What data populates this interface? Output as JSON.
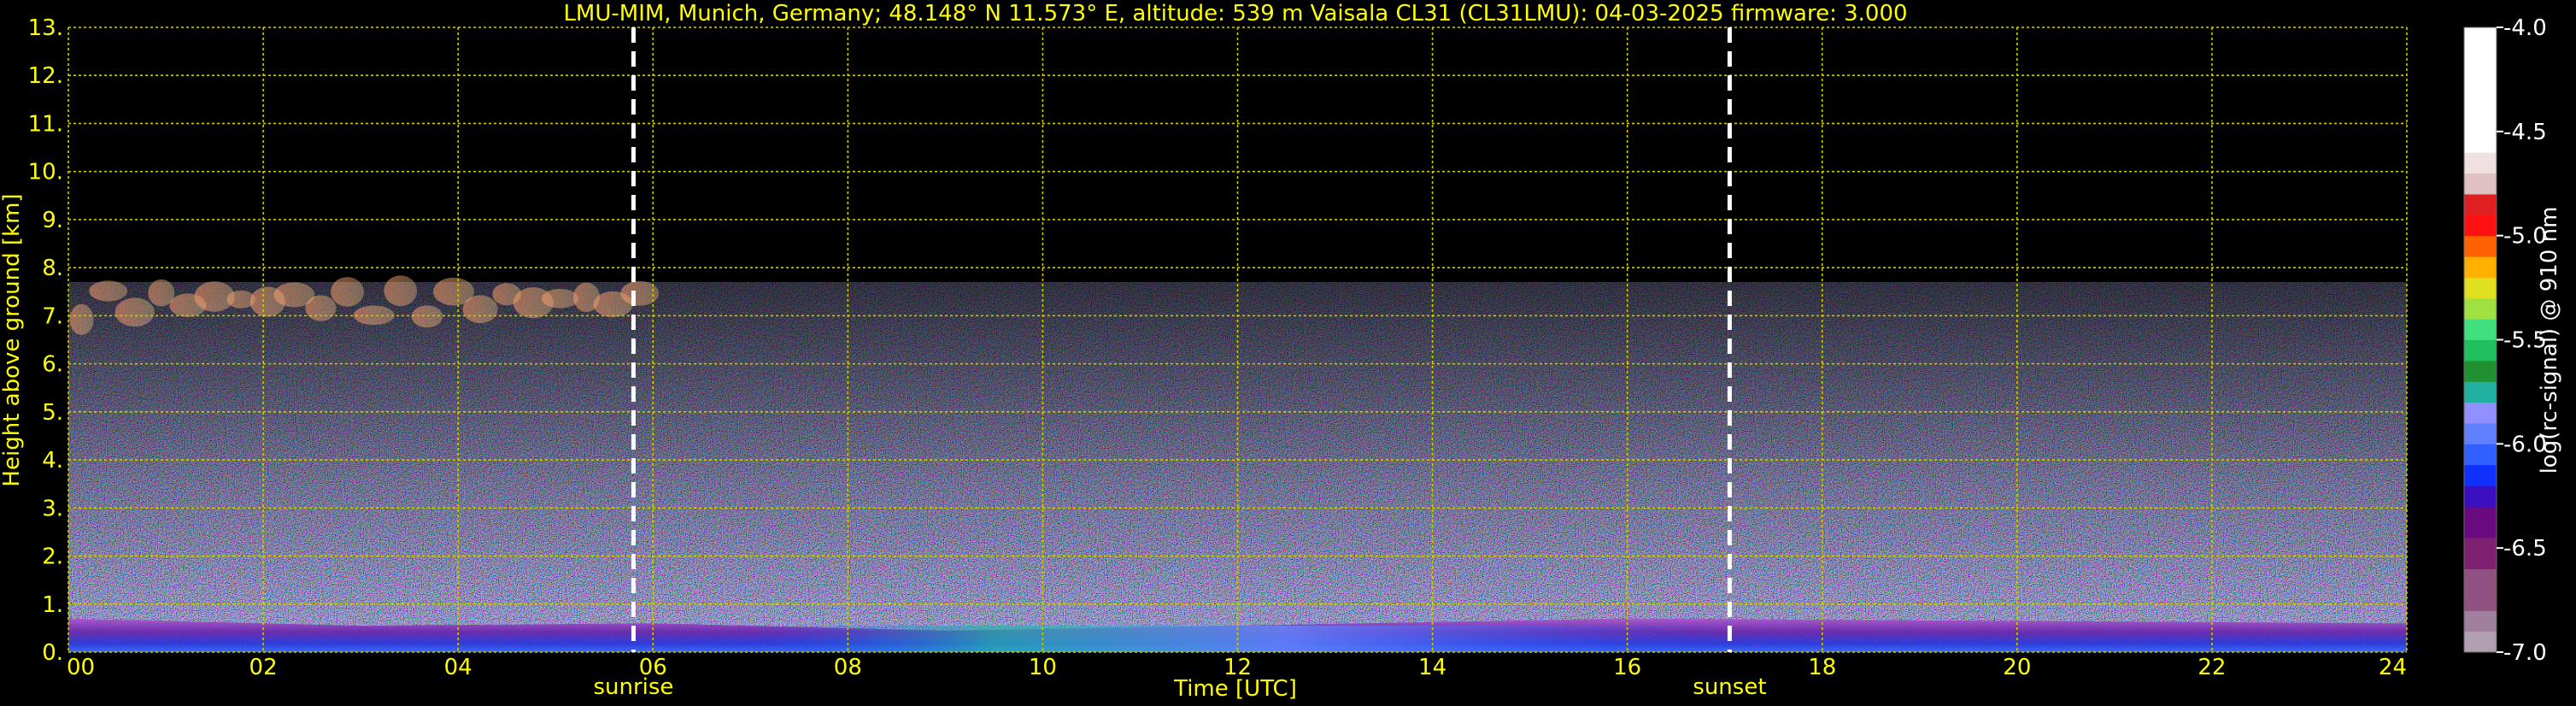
{
  "chart_data": {
    "type": "heatmap",
    "title": "LMU-MIM, Munich, Germany; 48.148° N 11.573° E, altitude: 539 m    Vaisala CL31 (CL31LMU): 04-03-2025    firmware: 3.000",
    "xlabel": "Time [UTC]",
    "ylabel": "Height above ground [km]",
    "xlim": [
      0,
      24
    ],
    "ylim": [
      0,
      13
    ],
    "x_ticks": [
      "00",
      "02",
      "04",
      "06",
      "08",
      "10",
      "12",
      "14",
      "16",
      "18",
      "20",
      "22",
      "24"
    ],
    "y_ticks": [
      "0.",
      "1.",
      "2.",
      "3.",
      "4.",
      "5.",
      "6.",
      "7.",
      "8.",
      "9.",
      "10.",
      "11.",
      "12.",
      "13."
    ],
    "grid": true,
    "markers": [
      {
        "label": "sunrise",
        "time": 5.8
      },
      {
        "label": "sunset",
        "time": 17.05
      }
    ],
    "colorbar": {
      "label": "log(rc-signal) @ 910 nm",
      "range": [
        -7.0,
        -4.0
      ],
      "ticks": [
        "-4.0",
        "-4.5",
        "-5.0",
        "-5.5",
        "-6.0",
        "-6.5",
        "-7.0"
      ]
    },
    "observations": {
      "data_top_km": 7.7,
      "boundary_layer": [
        {
          "time": 0,
          "top_km": 0.7
        },
        {
          "time": 3,
          "top_km": 0.55
        },
        {
          "time": 6,
          "top_km": 0.6
        },
        {
          "time": 9,
          "top_km": 0.45
        },
        {
          "time": 12,
          "top_km": 0.55
        },
        {
          "time": 16,
          "top_km": 0.7
        },
        {
          "time": 20,
          "top_km": 0.65
        },
        {
          "time": 24,
          "top_km": 0.6
        }
      ],
      "cloud_layer": {
        "from": 0,
        "to": 6,
        "bottom_km": 6.5,
        "top_km": 7.7
      }
    }
  },
  "colors": {
    "axis_text": "#ffff00",
    "grid": "#cccc00",
    "marker_line": "#ffffff",
    "colorbar_text": "#ffffff"
  }
}
